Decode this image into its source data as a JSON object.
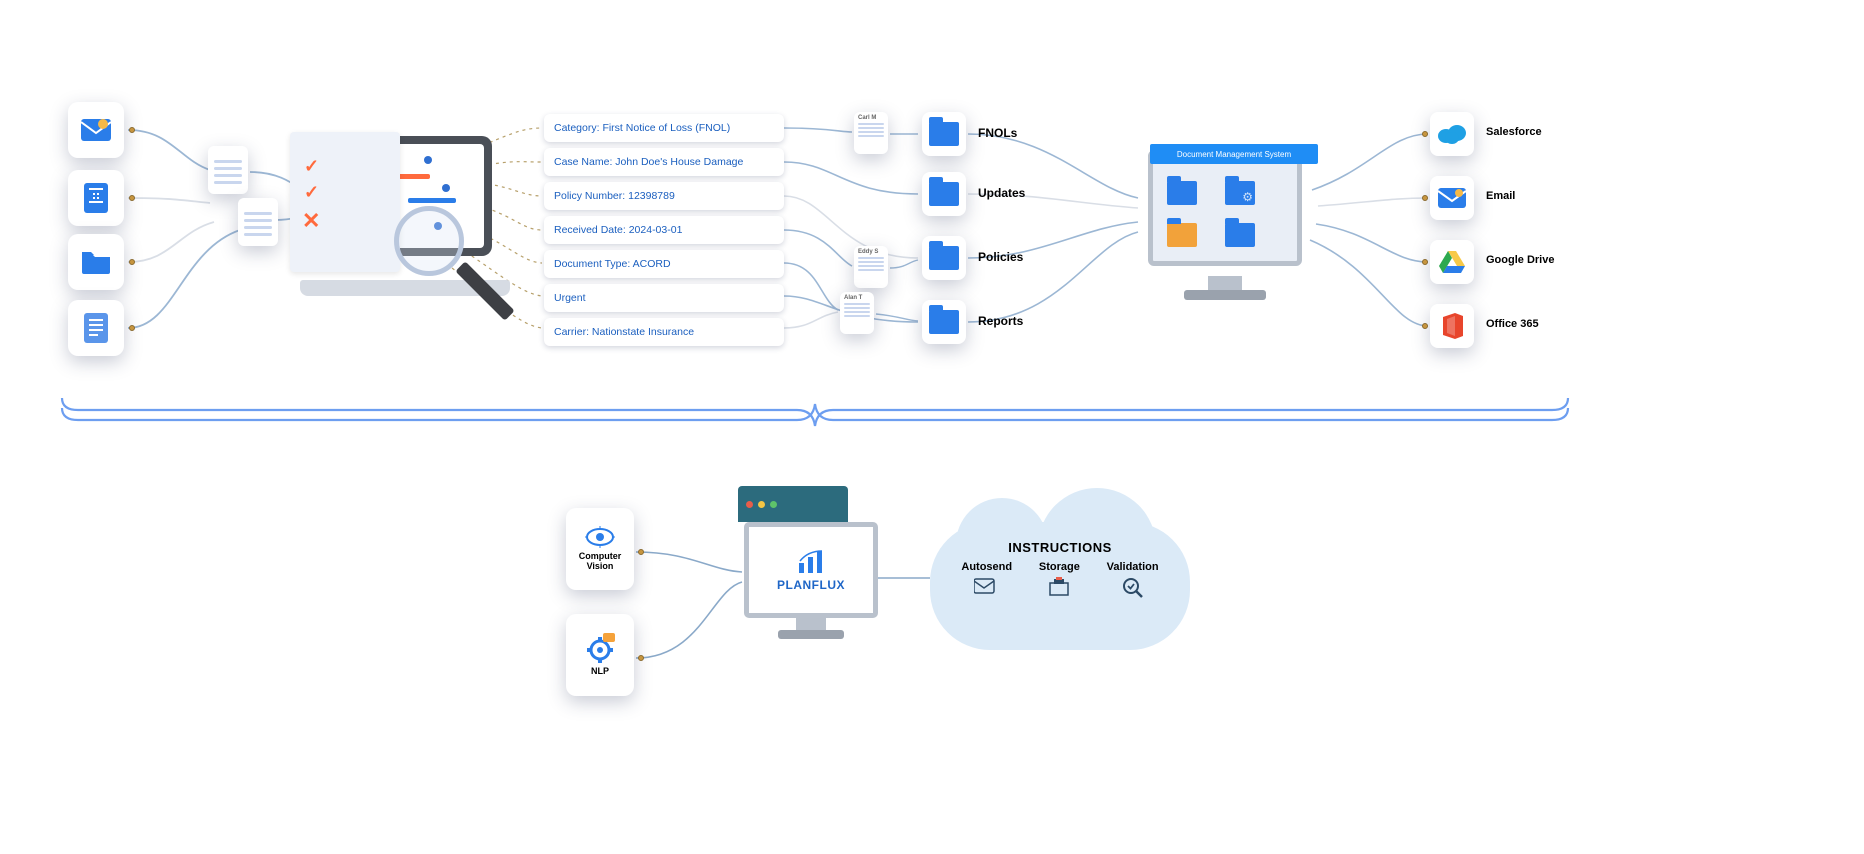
{
  "inputs": {
    "sources": [
      "email",
      "form",
      "folder",
      "document"
    ]
  },
  "meta": [
    "Category: First Notice of Loss (FNOL)",
    "Case Name: John Doe's House Damage",
    "Policy Number: 12398789",
    "Received Date: 2024-03-01",
    "Document Type: ACORD",
    "Urgent",
    "Carrier: Nationstate Insurance"
  ],
  "people": [
    "Carl M",
    "Eddy S",
    "Alan T"
  ],
  "folders": [
    "FNOLs",
    "Updates",
    "Policies",
    "Reports"
  ],
  "dms": {
    "header": "Document Management System"
  },
  "destinations": [
    "Salesforce",
    "Email",
    "Google Drive",
    "Office 365"
  ],
  "tech": {
    "cv": "Computer Vision",
    "nlp": "NLP"
  },
  "planflux": {
    "brand": "PLANFLUX"
  },
  "instructions": {
    "title": "INSTRUCTIONS",
    "items": [
      "Autosend",
      "Storage",
      "Validation"
    ]
  },
  "colors": {
    "blue": "#2a7de9",
    "line": "#8aa9c9",
    "dash": "#b7a06b",
    "braceBlue": "#6d9ef0"
  }
}
